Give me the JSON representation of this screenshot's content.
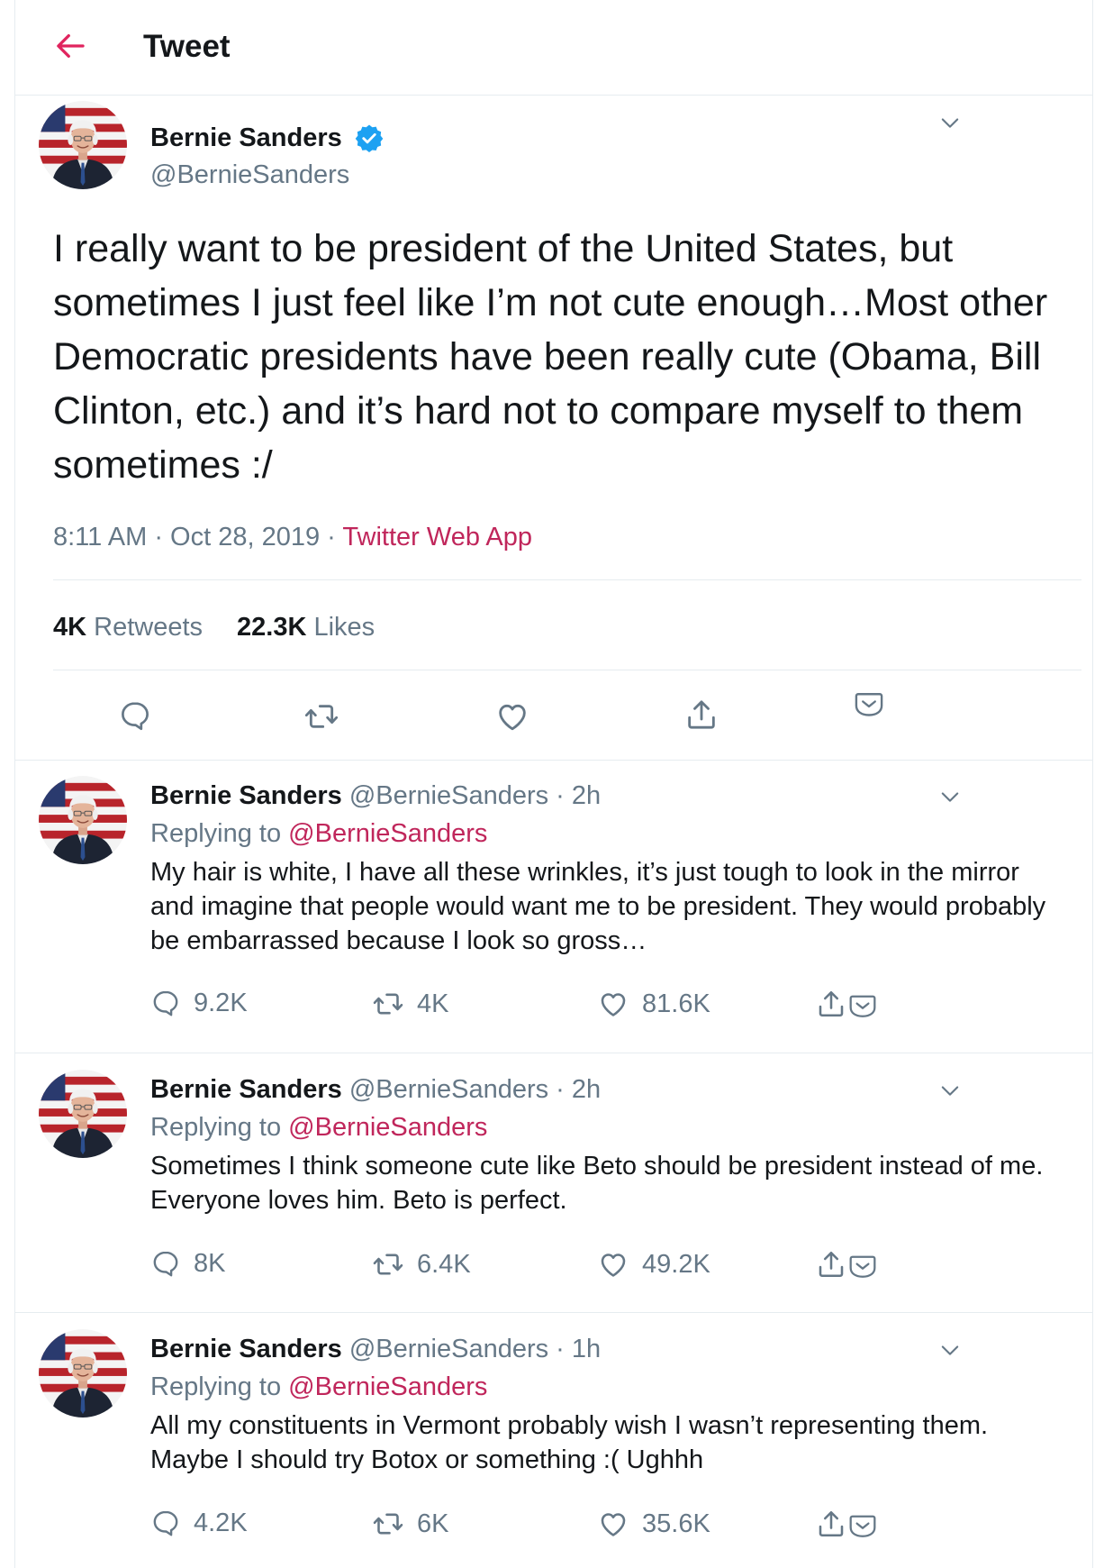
{
  "header": {
    "title": "Tweet"
  },
  "main_tweet": {
    "name": "Bernie Sanders",
    "handle": "@BernieSanders",
    "text": "I really want to be president of the United States, but sometimes I just feel like I’m not cute enough…Most other Democratic presidents have been really cute (Obama, Bill Clinton, etc.) and it’s hard not to compare myself to them sometimes :/",
    "time": "8:11 AM",
    "date": "Oct 28, 2019",
    "source": "Twitter Web App",
    "meta_sep": "·",
    "retweets_count": "4K",
    "retweets_label": "Retweets",
    "likes_count": "22.3K",
    "likes_label": "Likes"
  },
  "replies": [
    {
      "name": "Bernie Sanders",
      "handle": "@BernieSanders",
      "time": "· 2h",
      "replying_label": "Replying to",
      "replying_to": "@BernieSanders",
      "text": "My hair is white, I have all these wrinkles, it’s just tough to look in the mirror and imagine that people would want me to be president. They would probably be embarrassed because I look so gross…",
      "replies": "9.2K",
      "retweets": "4K",
      "likes": "81.6K"
    },
    {
      "name": "Bernie Sanders",
      "handle": "@BernieSanders",
      "time": "· 2h",
      "replying_label": "Replying to",
      "replying_to": "@BernieSanders",
      "text": "Sometimes I think someone cute like Beto should be president instead of me. Everyone loves him. Beto is perfect.",
      "replies": "8K",
      "retweets": "6.4K",
      "likes": "49.2K"
    },
    {
      "name": "Bernie Sanders",
      "handle": "@BernieSanders",
      "time": "· 1h",
      "replying_label": "Replying to",
      "replying_to": "@BernieSanders",
      "text": "All my constituents in Vermont probably wish I wasn’t representing them. Maybe I should try Botox or something :( Ughhh",
      "replies": "4.2K",
      "retweets": "6K",
      "likes": "35.6K"
    }
  ],
  "colors": {
    "accent": "#e0245e",
    "link": "#c0265b",
    "secondary_text": "#657786",
    "verified": "#1da1f2",
    "border": "#e6ecf0"
  },
  "icons": [
    "back-arrow-icon",
    "verified-badge-icon",
    "chevron-down-icon",
    "reply-icon",
    "retweet-icon",
    "like-icon",
    "share-icon",
    "dm-icon"
  ]
}
